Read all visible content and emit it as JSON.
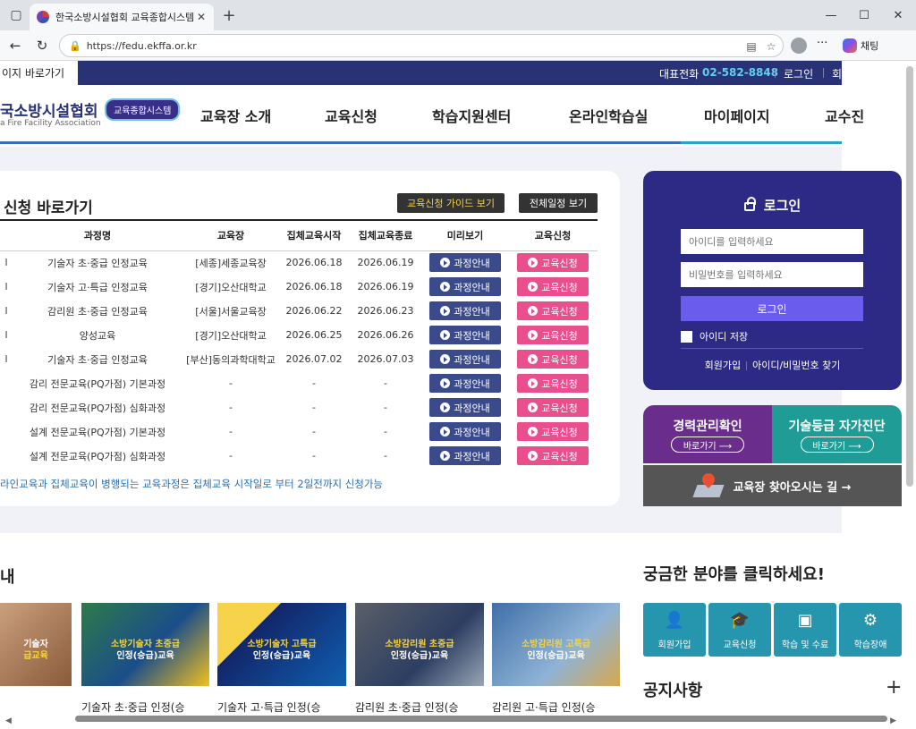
{
  "browser": {
    "tab_title": "한국소방시설협회 교육종합시스템",
    "url": "https://fedu.ekffa.or.kr",
    "copilot_label": "채팅"
  },
  "util_bar": {
    "shortcut": "이지 바로가기",
    "phone_label": "대표전화",
    "phone": "02-582-8848",
    "login": "로그인",
    "join": "회"
  },
  "header": {
    "logo": "국소방시설협회",
    "logo_sub": "a Fire Facility Association",
    "badge": "교육종합시스템",
    "menu": [
      "교육장 소개",
      "교육신청",
      "학습지원센터",
      "온라인학습실",
      "마이페이지",
      "교수진"
    ]
  },
  "courses": {
    "title": "신청 바로가기",
    "guide_button": "교육신청 가이드 보기",
    "schedule_button": "전체일정 보기",
    "columns": [
      "과정명",
      "교육장",
      "집체교육시작",
      "집체교육종료",
      "미리보기",
      "교육신청"
    ],
    "view_label": "과정안내",
    "apply_label": "교육신청",
    "rows": [
      {
        "mark": "l",
        "name": "기술자 초·중급 인정교육",
        "place": "[세종]세종교육장",
        "start": "2026.06.18",
        "end": "2026.06.19"
      },
      {
        "mark": "l",
        "name": "기술자 고·특급 인정교육",
        "place": "[경기]오산대학교",
        "start": "2026.06.18",
        "end": "2026.06.19"
      },
      {
        "mark": "l",
        "name": "감리원 초·중급 인정교육",
        "place": "[서울]서울교육장",
        "start": "2026.06.22",
        "end": "2026.06.23"
      },
      {
        "mark": "l",
        "name": "양성교육",
        "place": "[경기]오산대학교",
        "start": "2026.06.25",
        "end": "2026.06.26"
      },
      {
        "mark": "l",
        "name": "기술자 초·중급 인정교육",
        "place": "[부산]동의과학대학교",
        "start": "2026.07.02",
        "end": "2026.07.03"
      },
      {
        "mark": "",
        "name": "감리 전문교육(PQ가점) 기본과정",
        "place": "-",
        "start": "-",
        "end": "-"
      },
      {
        "mark": "",
        "name": "감리 전문교육(PQ가점) 심화과정",
        "place": "-",
        "start": "-",
        "end": "-"
      },
      {
        "mark": "",
        "name": "설계 전문교육(PQ가점) 기본과정",
        "place": "-",
        "start": "-",
        "end": "-"
      },
      {
        "mark": "",
        "name": "설계 전문교육(PQ가점) 심화과정",
        "place": "-",
        "start": "-",
        "end": "-"
      }
    ],
    "notice": "라인교육과 집체교육이 병행되는 교육과정은 집체교육 시작일로 부터 2일전까지 신청가능"
  },
  "login": {
    "title": "로그인",
    "id_placeholder": "아이디를 입력하세요",
    "pw_placeholder": "비밀번호를 입력하세요",
    "button": "로그인",
    "remember": "아이디 저장",
    "join": "회원가입",
    "find": "아이디/비밀번호 찾기"
  },
  "tiles": [
    {
      "label": "경력관리확인",
      "go": "바로가기 ⟶",
      "color": "#6a2d8c"
    },
    {
      "label": "기술등급 자가진단",
      "go": "바로가기 ⟶",
      "color": "#1f9c95"
    }
  ],
  "find_way": "교육장 찾아오시는 길 →",
  "lower": {
    "left_title": "내",
    "question": "궁금한 분야를 클릭하세요!",
    "thumbs": [
      {
        "cap1": "기술자",
        "cap2": "급교육",
        "title": ""
      },
      {
        "cap1": "소방기술자 초중급",
        "cap2": "인정(승급)교육",
        "title": "기술자 초·중급 인정(승"
      },
      {
        "cap1": "소방기술자 고특급",
        "cap2": "인정(승급)교육",
        "title": "기술자 고·특급 인정(승"
      },
      {
        "cap1": "소방감리원 초중급",
        "cap2": "인정(승급)교육",
        "title": "감리원 초·중급 인정(승"
      },
      {
        "cap1": "소방감리원 고특급",
        "cap2": "인정(승급)교육",
        "title": "감리원 고·특급 인정(승"
      }
    ],
    "quick": [
      {
        "label": "회원가입",
        "icon": "👤"
      },
      {
        "label": "교육신청",
        "icon": "🎓"
      },
      {
        "label": "학습 및 수료",
        "icon": "▣"
      },
      {
        "label": "학습장애",
        "icon": "⚙"
      }
    ],
    "notice_title": "공지사항",
    "notice_plus": "+"
  }
}
